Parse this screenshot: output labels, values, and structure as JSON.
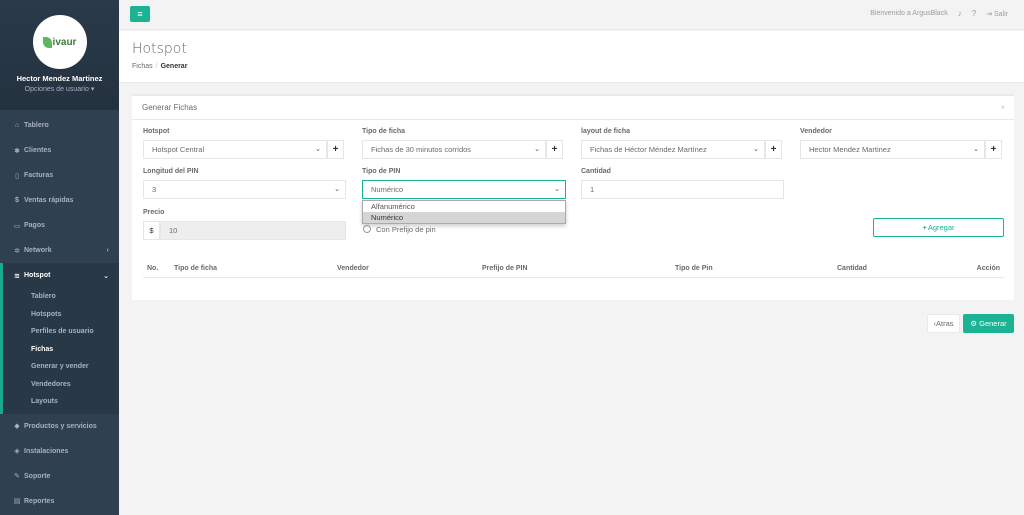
{
  "sidebar": {
    "logo_text": "ivaur",
    "user_name": "Hector Mendez Martinez",
    "user_options": "Opciones de usuario",
    "items": [
      {
        "label": "Tablero",
        "icon": "dashboard-icon",
        "glyph": "⌂"
      },
      {
        "label": "Clientes",
        "icon": "users-icon",
        "glyph": "👥"
      },
      {
        "label": "Facturas",
        "icon": "file-icon",
        "glyph": "▯"
      },
      {
        "label": "Ventas rápidas",
        "icon": "dollar-icon",
        "glyph": "$"
      },
      {
        "label": "Pagos",
        "icon": "money-icon",
        "glyph": "▭"
      },
      {
        "label": "Network",
        "icon": "sitemap-icon",
        "glyph": "✲"
      },
      {
        "label": "Hotspot",
        "icon": "wifi-icon",
        "glyph": "≋"
      },
      {
        "label": "Productos y servicios",
        "icon": "tag-icon",
        "glyph": "◆"
      },
      {
        "label": "Instalaciones",
        "icon": "diamond-icon",
        "glyph": "◈"
      },
      {
        "label": "Soporte",
        "icon": "wrench-icon",
        "glyph": "✎"
      },
      {
        "label": "Reportes",
        "icon": "book-icon",
        "glyph": "▤"
      }
    ],
    "hotspot_sub": [
      "Tablero",
      "Hotspots",
      "Perfiles de usuario",
      "Fichas",
      "Generar y vender",
      "Vendedores",
      "Layouts"
    ]
  },
  "topbar": {
    "welcome": "Bienvenido a ArgusBlack",
    "logout": "Salir"
  },
  "page": {
    "title": "Hotspot",
    "breadcrumb_parent": "Fichas",
    "breadcrumb_current": "Generar"
  },
  "panel": {
    "title": "Generar Fichas",
    "fields": {
      "hotspot_label": "Hotspot",
      "hotspot_value": "Hotspot Central",
      "tipo_ficha_label": "Tipo de ficha",
      "tipo_ficha_value": "Fichas de 30 minutos corridos",
      "layout_label": "layout de ficha",
      "layout_value": "Fichas de Héctor Méndez Martínez",
      "vendedor_label": "Vendedor",
      "vendedor_value": "Hector Mendez Martinez",
      "longitud_label": "Longitud del PIN",
      "longitud_value": "3",
      "tipo_pin_label": "Tipo de PIN",
      "tipo_pin_value": "Numérico",
      "tipo_pin_options": [
        "Alfanumérico",
        "Numérico"
      ],
      "cantidad_label": "Cantidad",
      "cantidad_value": "1",
      "precio_label": "Precio",
      "precio_prefix": "$",
      "precio_value": "10",
      "prefijo_radio_label": "Con Prefijo de pin"
    },
    "agregar_label": "Agregar"
  },
  "table": {
    "headers": [
      "No.",
      "Tipo de ficha",
      "Vendedor",
      "Prefijo de PIN",
      "Tipo de Pin",
      "Cantidad",
      "Acción"
    ]
  },
  "actions": {
    "atras": "Atras",
    "generar": "Generar"
  },
  "colors": {
    "accent": "#1ab394",
    "sidebar_bg": "#2f4050"
  }
}
